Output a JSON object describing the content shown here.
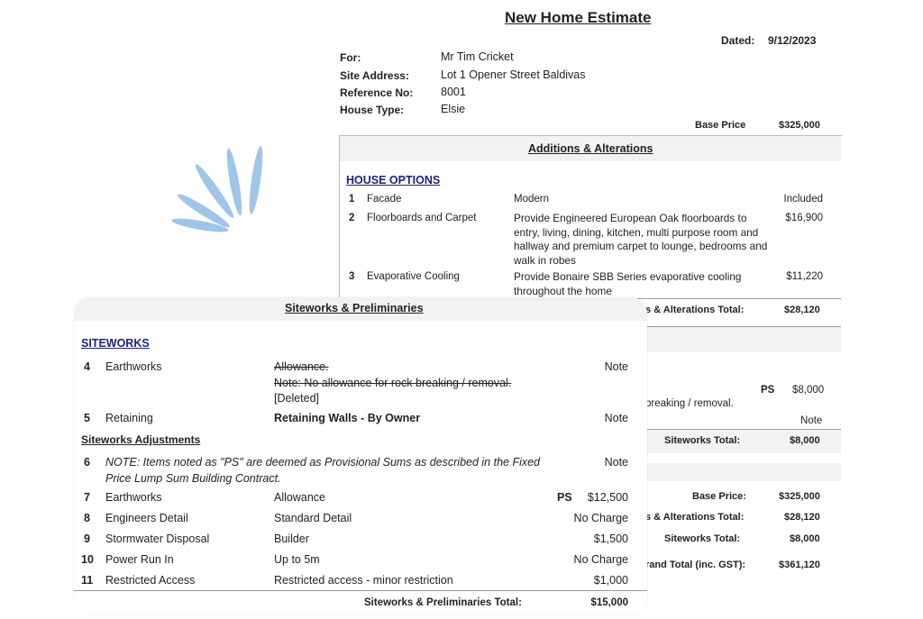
{
  "estimate": {
    "title": "New Home Estimate",
    "dated_label": "Dated:",
    "dated_value": "9/12/2023",
    "for_label": "For:",
    "for_value": "Mr Tim Cricket",
    "site_label": "Site Address:",
    "site_value": "Lot 1 Opener Street Baldivas",
    "ref_label": "Reference No:",
    "ref_value": "8001",
    "house_label": "House Type:",
    "house_value": "Elsie",
    "base_price_label": "Base Price",
    "base_price_value": "$325,000"
  },
  "additions": {
    "heading": "Additions & Alterations",
    "section": "HOUSE OPTIONS",
    "items": [
      {
        "num": "1",
        "name": "Facade",
        "desc": "Modern",
        "price": "Included"
      },
      {
        "num": "2",
        "name": "Floorboards and Carpet",
        "desc": "Provide Engineered European Oak floorboards to entry, living, dining, kitchen, multi purpose room and hallway and premium carpet to lounge, bedrooms and walk in robes",
        "price": "$16,900"
      },
      {
        "num": "3",
        "name": "Evaporative Cooling",
        "desc": "Provide Bonaire SBB Series evaporative cooling throughout the home",
        "price": "$11,220"
      }
    ],
    "total_label": "s & Alterations Total:",
    "total_value": "$28,120"
  },
  "back_siteworks": {
    "ps": "PS",
    "ps_value": "$8,000",
    "partial_text": "breaking / removal.",
    "note": "Note",
    "total_label": "Siteworks  Total:",
    "total_value": "$8,000"
  },
  "summary": {
    "base_label": "Base Price:",
    "base_value": "$325,000",
    "alterations_label": "s & Alterations Total:",
    "alterations_value": "$28,120",
    "siteworks_label": "Siteworks  Total:",
    "siteworks_value": "$8,000",
    "grand_label": "rand Total (inc. GST):",
    "grand_value": "$361,120"
  },
  "siteworks": {
    "heading": "Siteworks & Preliminaries",
    "section": "SITEWORKS",
    "row4": {
      "num": "4",
      "name": "Earthworks",
      "line1": "Allowance.",
      "line2": "Note: No allowance for rock breaking / removal.",
      "line3": "[Deleted]",
      "price": "Note"
    },
    "row5": {
      "num": "5",
      "name": "Retaining",
      "desc": "Retaining Walls - By Owner",
      "price": "Note"
    },
    "adjustments": "Siteworks Adjustments",
    "row6": {
      "num": "6",
      "line1": "NOTE: Items noted as \"PS\" are deemed as Provisional Sums as described in the Fixed",
      "line2": "Price Lump Sum Building Contract.",
      "price": "Note"
    },
    "rows": [
      {
        "num": "7",
        "name": "Earthworks",
        "desc": "Allowance",
        "ps": "PS",
        "price": "$12,500"
      },
      {
        "num": "8",
        "name": "Engineers Detail",
        "desc": "Standard Detail",
        "ps": "",
        "price": "No Charge"
      },
      {
        "num": "9",
        "name": "Stormwater Disposal",
        "desc": "Builder",
        "ps": "",
        "price": "$1,500"
      },
      {
        "num": "10",
        "name": "Power Run In",
        "desc": "Up to 5m",
        "ps": "",
        "price": "No Charge"
      },
      {
        "num": "11",
        "name": "Restricted Access",
        "desc": "Restricted access - minor restriction",
        "ps": "",
        "price": "$1,000"
      }
    ],
    "total_label": "Siteworks & Preliminaries Total:",
    "total_value": "$15,000"
  },
  "colors": {
    "accent_blue": "#9fc5e8",
    "heading_navy": "#1a237e",
    "band_grey": "#f2f2f2"
  }
}
